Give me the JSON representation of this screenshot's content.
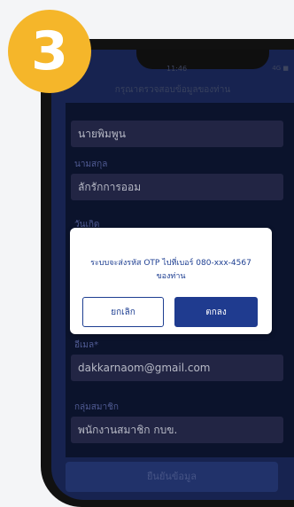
{
  "step": {
    "number": "3"
  },
  "status_bar": {
    "time": "11:46",
    "right": "4G ■"
  },
  "header": {
    "title": "กรุณาตรวจสอบข้อมูลของท่าน"
  },
  "form": {
    "first_name_value": "นายพิมพูน",
    "last_name_label": "นามสกุล",
    "last_name_value": "ลักรักการออม",
    "birthdate_label": "วันเกิด",
    "email_label": "อีเมล*",
    "email_value": "dakkarnaom@gmail.com",
    "group_label": "กลุ่มสมาชิก",
    "group_value": "พนักงานสมาชิก กบข."
  },
  "confirm_button": {
    "label": "ยืนยันข้อมูล"
  },
  "modal": {
    "message_line1": "ระบบจะส่งรหัส OTP ไปที่เบอร์ 080-xxx-4567",
    "message_line2": "ของท่าน",
    "cancel_label": "ยกเลิก",
    "ok_label": "ตกลง"
  },
  "colors": {
    "badge": "#f5b62a",
    "primary": "#1f3b8f",
    "screen_bg": "#1a2757"
  }
}
